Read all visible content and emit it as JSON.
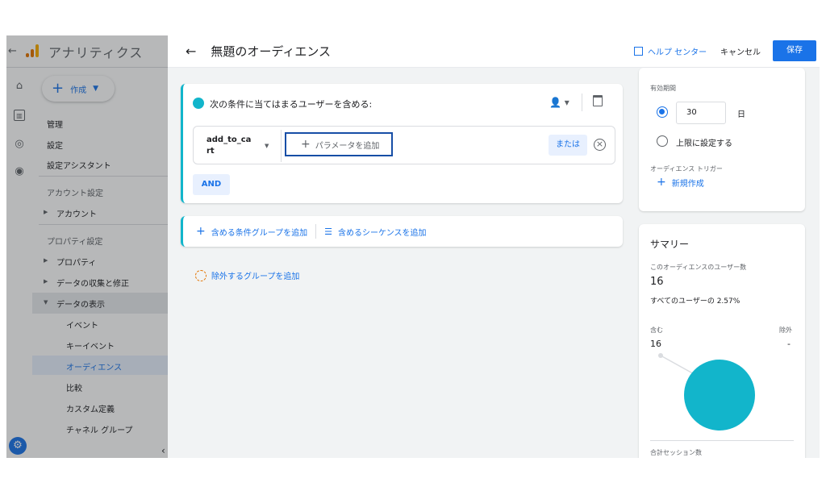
{
  "app": {
    "back_icon": "←",
    "title": "アナリティクス",
    "create_label": "作成",
    "nav": {
      "admin": "管理",
      "settings": "設定",
      "setup_assistant": "設定アシスタント",
      "account_settings": "アカウント設定",
      "account": "アカウント",
      "property_settings": "プロパティ設定",
      "property": "プロパティ",
      "data_collection": "データの収集と修正",
      "data_display": "データの表示",
      "events": "イベント",
      "key_events": "キーイベント",
      "audiences": "オーディエンス",
      "comparisons": "比較",
      "custom_definitions": "カスタム定義",
      "channel_groups": "チャネル グループ"
    }
  },
  "editor": {
    "title": "無題のオーディエンス",
    "help_label": "ヘルプ センター",
    "cancel_label": "キャンセル",
    "save_label": "保存",
    "condition": {
      "title": "次の条件に当てはまるユーザーを含める:",
      "event": "add_to_cart",
      "add_param": "パラメータを追加",
      "or_label": "または",
      "and_label": "AND"
    },
    "add_group": "含める条件グループを追加",
    "add_sequence": "含めるシーケンスを追加",
    "add_exclude": "除外するグループを追加"
  },
  "duration": {
    "label": "有効期間",
    "value": "30",
    "unit": "日",
    "max_label": "上限に設定する",
    "trigger_label": "オーディエンス トリガー",
    "new_label": "新規作成"
  },
  "summary": {
    "title": "サマリー",
    "users_label": "このオーディエンスのユーザー数",
    "users_value": "16",
    "percent_text": "すべてのユーザーの 2.57%",
    "include_label": "含む",
    "exclude_label": "除外",
    "include_value": "16",
    "exclude_value": "-",
    "sessions_label": "合計セッション数",
    "pie_color": "#12b5cb"
  }
}
